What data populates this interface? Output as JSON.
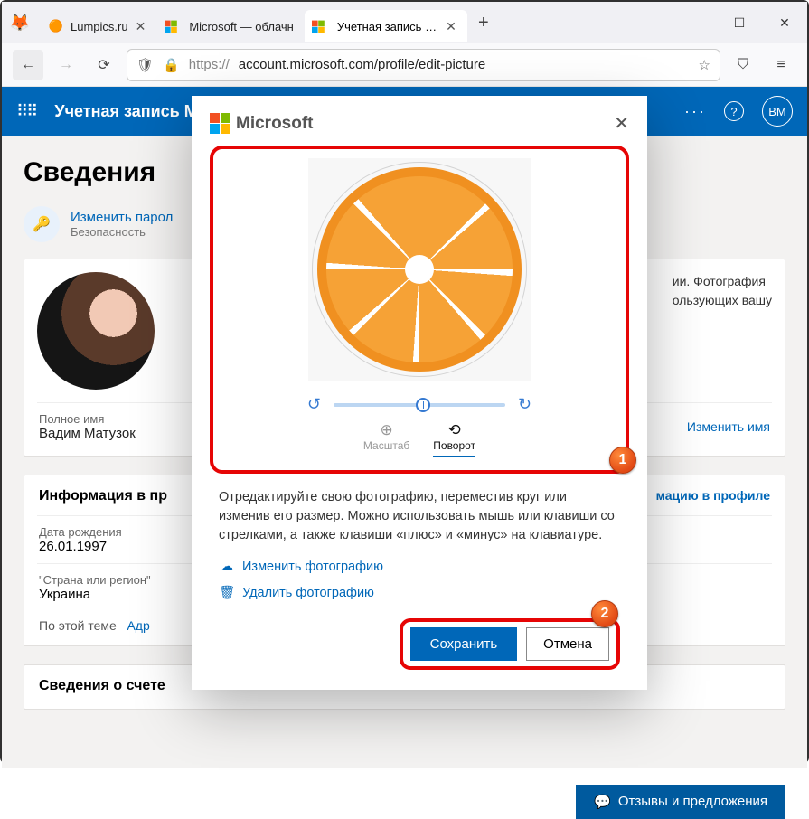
{
  "tabs": [
    {
      "title": "Lumpics.ru",
      "active": false
    },
    {
      "title": "Microsoft — облачн",
      "active": false
    },
    {
      "title": "Учетная запись Май",
      "active": true
    }
  ],
  "url_prefix": "https://",
  "url_rest": "account.microsoft.com/profile/edit-picture",
  "header": {
    "title": "Учетная запись М",
    "avatar_initials": "ВМ"
  },
  "page": {
    "heading": "Сведения",
    "pw_change": "Изменить парол",
    "pw_sub": "Безопасность",
    "photo_hint1": "ии. Фотография",
    "photo_hint2": "ользующих вашу",
    "full_name_label": "Полное имя",
    "full_name_value": "Вадим Матузок",
    "edit_name": "Изменить имя",
    "info_section": "Информация в пр",
    "info_link": "мацию в профиле",
    "dob_label": "Дата рождения",
    "dob_value": "26.01.1997",
    "country_label": "\"Страна или регион\"",
    "country_value": "Украина",
    "theme_label": "По этой теме",
    "theme_link": "Адр",
    "account_section": "Сведения о счете",
    "feedback": "Отзывы и предложения"
  },
  "modal": {
    "brand": "Microsoft",
    "tab_zoom": "Масштаб",
    "tab_rotate": "Поворот",
    "instructions": "Отредактируйте свою фотографию, переместив круг или изменив его размер. Можно использовать мышь или клавиши со стрелками, а также клавиши «плюс» и «минус» на клавиатуре.",
    "change_photo": "Изменить фотографию",
    "delete_photo": "Удалить фотографию",
    "save": "Сохранить",
    "cancel": "Отмена",
    "marker1": "1",
    "marker2": "2"
  }
}
